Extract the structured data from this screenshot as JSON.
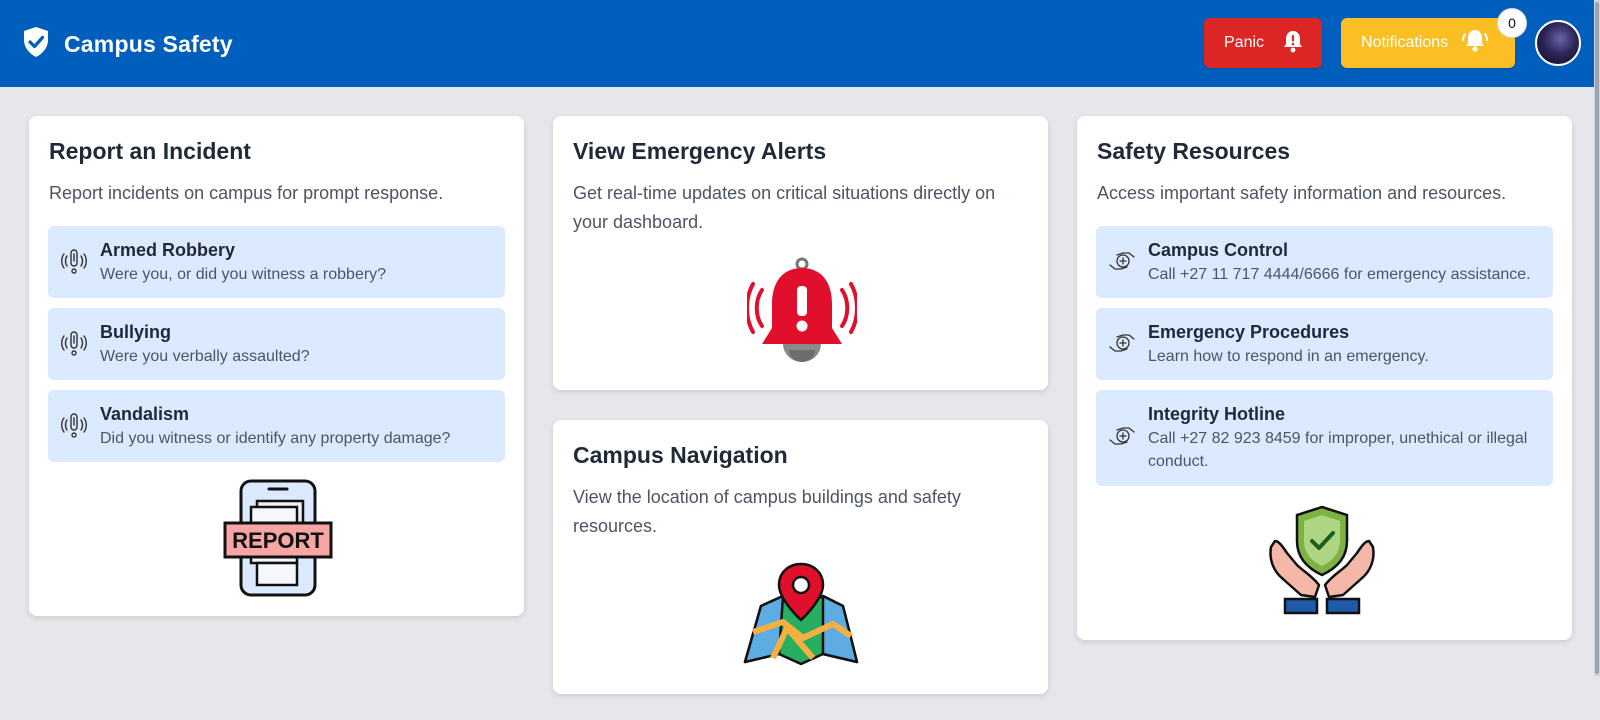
{
  "header": {
    "brand_icon": "shield-check-icon",
    "title": "Campus Safety",
    "panic_label": "Panic",
    "panic_icon": "bell-exclamation-icon",
    "notifications_label": "Notifications",
    "notifications_icon": "bell-ringing-icon",
    "notifications_count": "0",
    "colors": {
      "bar": "#005fbd",
      "panic": "#dc2626",
      "notifications": "#fbbf24"
    }
  },
  "report": {
    "title": "Report an Incident",
    "description": "Report incidents on campus for prompt response.",
    "items": [
      {
        "title": "Armed Robbery",
        "description": "Were you, or did you witness a robbery?",
        "icon": "alert-signal-icon"
      },
      {
        "title": "Bullying",
        "description": "Were you verbally assaulted?",
        "icon": "alert-signal-icon"
      },
      {
        "title": "Vandalism",
        "description": "Did you witness or identify any property damage?",
        "icon": "alert-signal-icon"
      }
    ],
    "illustration_label": "REPORT"
  },
  "alerts": {
    "title": "View Emergency Alerts",
    "description": "Get real-time updates on critical situations directly on your dashboard.",
    "illustration": "alarm-bell-icon"
  },
  "navigation": {
    "title": "Campus Navigation",
    "description": "View the location of campus buildings and safety resources.",
    "illustration": "map-pin-icon"
  },
  "resources": {
    "title": "Safety Resources",
    "description": "Access important safety information and resources.",
    "items": [
      {
        "title": "Campus Control",
        "description": "Call +27 11 717 4444/6666 for emergency assistance.",
        "icon": "care-hands-icon"
      },
      {
        "title": "Emergency Procedures",
        "description": "Learn how to respond in an emergency.",
        "icon": "care-hands-icon"
      },
      {
        "title": "Integrity Hotline",
        "description": "Call +27 82 923 8459 for improper, unethical or illegal conduct.",
        "icon": "care-hands-icon"
      }
    ],
    "illustration": "shield-hands-icon"
  }
}
